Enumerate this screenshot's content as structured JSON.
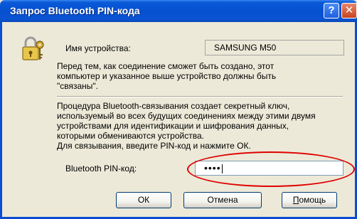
{
  "window": {
    "title": "Запрос Bluetooth PIN-кода",
    "help_button": "?",
    "close_button": "✕"
  },
  "icon": {
    "name": "key-lock-icon"
  },
  "device": {
    "label": "Имя устройства:",
    "value": "SAMSUNG M50"
  },
  "text": {
    "para1": [
      "Перед тем, как соединение сможет быть создано, этот",
      "компьютер и указанное выше устройство должны быть",
      "\"связаны\"."
    ],
    "para2": [
      "Процедура Bluetooth-связывания создает секретный ключ,",
      "используемый во всех будущих соединениях между этими двумя",
      "устройствами для идентификации и шифрования данных,",
      "которыми обмениваются устройства."
    ],
    "para3": "Для связывания, введите PIN-код и нажмите ОК."
  },
  "pin": {
    "label": "Bluetooth PIN-код:",
    "value": "••••"
  },
  "buttons": {
    "ok": "ОК",
    "cancel": "Отмена",
    "help": "Помощь"
  },
  "colors": {
    "titlebar": "#0550d0",
    "dialog_bg": "#ece9d8",
    "highlight": "#e00000"
  }
}
